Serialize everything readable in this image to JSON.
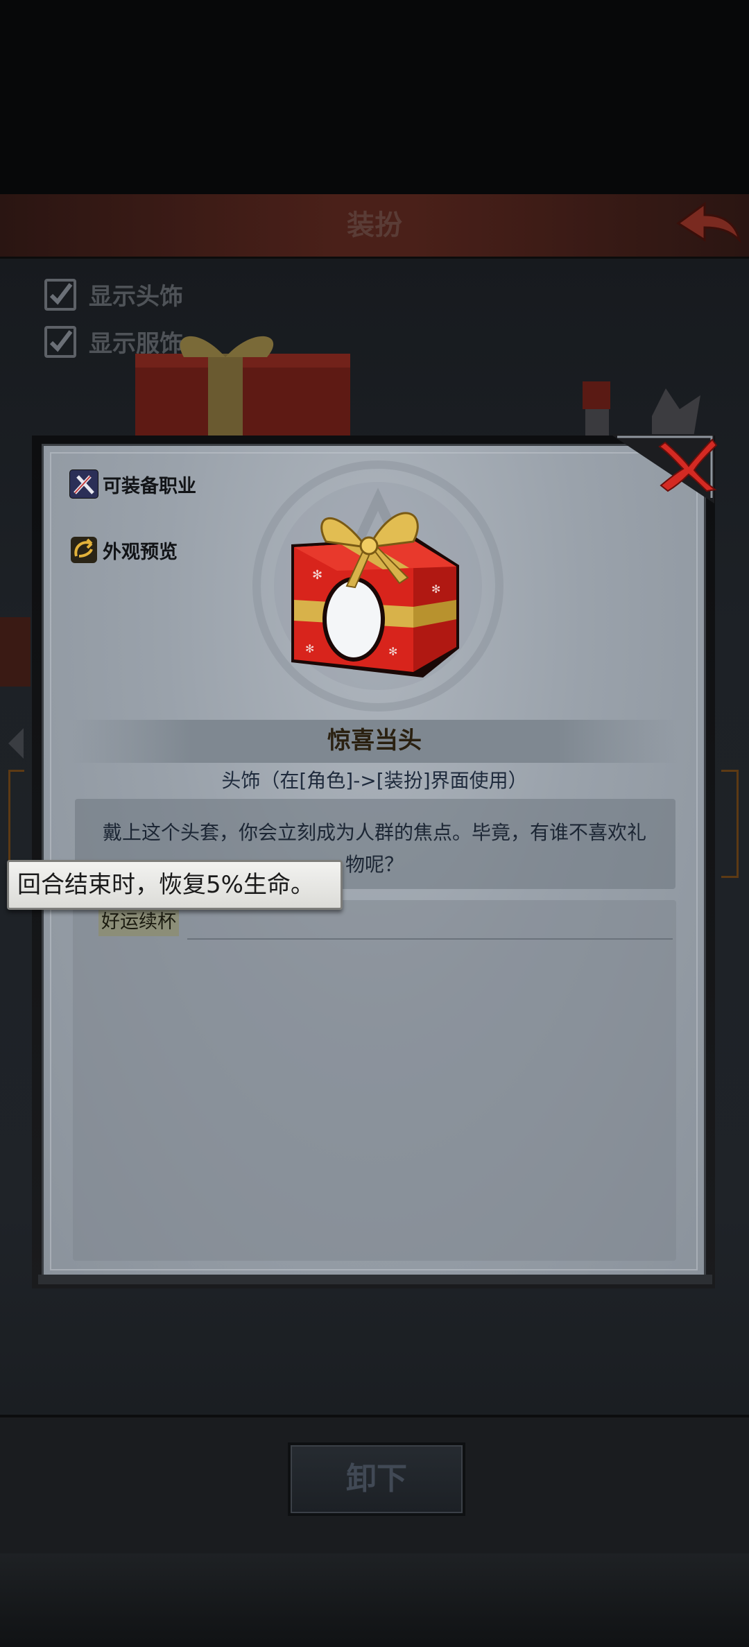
{
  "header": {
    "title": "装扮"
  },
  "toggles": [
    {
      "label": "显示头饰",
      "checked": true
    },
    {
      "label": "显示服饰",
      "checked": true
    }
  ],
  "actions": {
    "unequip_label": "卸下"
  },
  "modal": {
    "side_menu": [
      {
        "label": "可装备职业",
        "icon": "sword-class-icon"
      },
      {
        "label": "外观预览",
        "icon": "appearance-preview-icon"
      }
    ],
    "item": {
      "name": "惊喜当头",
      "type_line": "头饰（在[角色]->[装扮]界面使用）",
      "description": "戴上这个头套，你会立刻成为人群的焦点。毕竟，有谁不喜欢礼物呢？",
      "effect_name": "好运续杯"
    },
    "tooltip": "回合结束时，恢复5%生命。"
  },
  "colors": {
    "close_red": "#d42a23",
    "gift_red": "#d8241c",
    "ribbon_gold": "#d8b24a",
    "header_red": "#4a2019"
  }
}
